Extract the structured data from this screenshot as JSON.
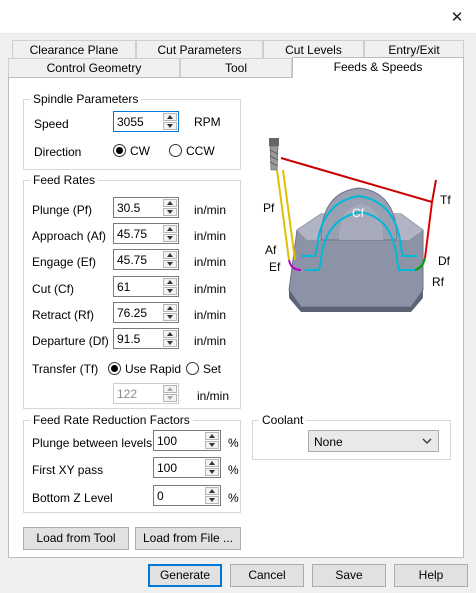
{
  "window": {
    "close_symbol": "✕"
  },
  "tabs": {
    "row1": [
      "Clearance Plane",
      "Cut Parameters",
      "Cut Levels",
      "Entry/Exit"
    ],
    "row2": [
      "Control Geometry",
      "Tool",
      "Feeds & Speeds"
    ],
    "active": "Feeds & Speeds"
  },
  "spindle": {
    "title": "Spindle Parameters",
    "speed_label": "Speed",
    "speed_value": "3055",
    "speed_unit": "RPM",
    "direction_label": "Direction",
    "cw_label": "CW",
    "ccw_label": "CCW",
    "selected": "CW"
  },
  "feed_rates": {
    "title": "Feed Rates",
    "unit": "in/min",
    "rows": [
      {
        "label": "Plunge (Pf)",
        "value": "30.5"
      },
      {
        "label": "Approach (Af)",
        "value": "45.75"
      },
      {
        "label": "Engage (Ef)",
        "value": "45.75"
      },
      {
        "label": "Cut (Cf)",
        "value": "61"
      },
      {
        "label": "Retract (Rf)",
        "value": "76.25"
      },
      {
        "label": "Departure  (Df)",
        "value": "91.5"
      }
    ],
    "transfer_label": "Transfer (Tf)",
    "use_rapid_label": "Use Rapid",
    "set_label": "Set",
    "transfer_selected": "Use Rapid",
    "transfer_value": "122"
  },
  "diagram": {
    "labels": {
      "pf": "Pf",
      "tf": "Tf",
      "cf": "Cf",
      "af": "Af",
      "ef": "Ef",
      "df": "Df",
      "rf": "Rf"
    },
    "colors": {
      "plunge": "#e0c000",
      "approach": "#c000c0",
      "cut": "#00b8d8",
      "departure": "#00a000",
      "retract": "#e00000",
      "transfer": "#c80000",
      "stock": "#8d93a6"
    }
  },
  "reduction": {
    "title": "Feed Rate Reduction Factors",
    "unit": "%",
    "rows": [
      {
        "label": "Plunge between levels",
        "value": "100"
      },
      {
        "label": "First XY pass",
        "value": "100"
      },
      {
        "label": "Bottom Z Level",
        "value": "0"
      }
    ]
  },
  "coolant": {
    "title": "Coolant",
    "value": "None"
  },
  "buttons": {
    "load_tool": "Load from Tool",
    "load_file": "Load from File ...",
    "generate": "Generate",
    "cancel": "Cancel",
    "save": "Save",
    "help": "Help"
  }
}
